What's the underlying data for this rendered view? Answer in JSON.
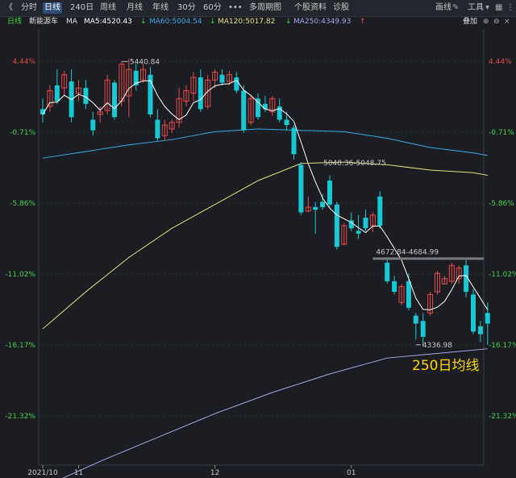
{
  "toolbar": {
    "items": [
      "《",
      "分时",
      "日线",
      "240日",
      "周线",
      "月线",
      "年线",
      "30分",
      "60分",
      "•••",
      "多周期图",
      "个股资料",
      "诊股"
    ],
    "right": [
      "画线",
      "工具"
    ]
  },
  "infobar": {
    "period": "日线",
    "name": "新能源车",
    "ma_label": "MA",
    "ma5": "MA5:4520.43",
    "ma60": "MA60:5004.54",
    "ma120": "MA120:5017.82",
    "ma250": "MA250:4349.93",
    "arrow_down": "↓",
    "arrow_up": "↑",
    "right_label": "叠加"
  },
  "colors": {
    "background": "#1b1d22",
    "up": "#e84a4a",
    "down": "#17c9d6",
    "ma5": "#ffffff",
    "ma60": "#3aa8e0",
    "ma120": "#e3e07a",
    "ma250": "#a7a7e8",
    "pos": "#e84a4a",
    "zero": "#3fd14a",
    "neg": "#3fd14a",
    "annotation": "#ffd700"
  },
  "chart_data": {
    "type": "candlestick",
    "y_percent_ticks": [
      "4.44%",
      "-0.71%",
      "-5.86%",
      "-11.02%",
      "-16.17%",
      "-21.32%"
    ],
    "y_values": [
      4.44,
      -0.71,
      -5.86,
      -11.02,
      -16.17,
      -21.32
    ],
    "x_ticks": [
      "2021/10",
      "11",
      "12",
      "01"
    ],
    "x_tick_index": [
      0,
      5,
      24,
      43
    ],
    "callouts": [
      "5440.84",
      "5048.36-5048.75",
      "4672.84-4684.99",
      "4336.98"
    ],
    "annotation": "250日均线",
    "price_ref": 5200,
    "candles": [
      {
        "o": 5250,
        "h": 5290,
        "l": 5200,
        "c": 5230
      },
      {
        "o": 5260,
        "h": 5340,
        "l": 5240,
        "c": 5320
      },
      {
        "o": 5340,
        "h": 5400,
        "l": 5270,
        "c": 5280
      },
      {
        "o": 5330,
        "h": 5395,
        "l": 5300,
        "c": 5380
      },
      {
        "o": 5355,
        "h": 5400,
        "l": 5200,
        "c": 5220
      },
      {
        "o": 5310,
        "h": 5360,
        "l": 5280,
        "c": 5330
      },
      {
        "o": 5330,
        "h": 5360,
        "l": 5250,
        "c": 5270
      },
      {
        "o": 5210,
        "h": 5240,
        "l": 5150,
        "c": 5170
      },
      {
        "o": 5230,
        "h": 5260,
        "l": 5200,
        "c": 5240
      },
      {
        "o": 5245,
        "h": 5380,
        "l": 5230,
        "c": 5360
      },
      {
        "o": 5350,
        "h": 5360,
        "l": 5210,
        "c": 5220
      },
      {
        "o": 5280,
        "h": 5430,
        "l": 5260,
        "c": 5420
      },
      {
        "o": 5300,
        "h": 5440,
        "l": 5220,
        "c": 5400
      },
      {
        "o": 5395,
        "h": 5420,
        "l": 5320,
        "c": 5340
      },
      {
        "o": 5360,
        "h": 5420,
        "l": 5350,
        "c": 5400
      },
      {
        "o": 5380,
        "h": 5410,
        "l": 5220,
        "c": 5230
      },
      {
        "o": 5210,
        "h": 5250,
        "l": 5130,
        "c": 5140
      },
      {
        "o": 5150,
        "h": 5210,
        "l": 5130,
        "c": 5190
      },
      {
        "o": 5175,
        "h": 5210,
        "l": 5160,
        "c": 5200
      },
      {
        "o": 5200,
        "h": 5330,
        "l": 5180,
        "c": 5290
      },
      {
        "o": 5280,
        "h": 5340,
        "l": 5260,
        "c": 5320
      },
      {
        "o": 5310,
        "h": 5390,
        "l": 5280,
        "c": 5370
      },
      {
        "o": 5370,
        "h": 5400,
        "l": 5240,
        "c": 5250
      },
      {
        "o": 5260,
        "h": 5380,
        "l": 5250,
        "c": 5360
      },
      {
        "o": 5360,
        "h": 5400,
        "l": 5330,
        "c": 5390
      },
      {
        "o": 5380,
        "h": 5400,
        "l": 5340,
        "c": 5350
      },
      {
        "o": 5355,
        "h": 5395,
        "l": 5340,
        "c": 5380
      },
      {
        "o": 5370,
        "h": 5390,
        "l": 5310,
        "c": 5320
      },
      {
        "o": 5320,
        "h": 5340,
        "l": 5160,
        "c": 5170
      },
      {
        "o": 5200,
        "h": 5300,
        "l": 5190,
        "c": 5290
      },
      {
        "o": 5290,
        "h": 5310,
        "l": 5210,
        "c": 5220
      },
      {
        "o": 5270,
        "h": 5300,
        "l": 5240,
        "c": 5250
      },
      {
        "o": 5240,
        "h": 5300,
        "l": 5225,
        "c": 5290
      },
      {
        "o": 5260,
        "h": 5290,
        "l": 5200,
        "c": 5210
      },
      {
        "o": 5210,
        "h": 5240,
        "l": 5170,
        "c": 5190
      },
      {
        "o": 5180,
        "h": 5190,
        "l": 5060,
        "c": 5080
      },
      {
        "o": 5040,
        "h": 5050,
        "l": 4850,
        "c": 4860
      },
      {
        "o": 4865,
        "h": 4920,
        "l": 4860,
        "c": 4880
      },
      {
        "o": 4880,
        "h": 4900,
        "l": 4780,
        "c": 4870
      },
      {
        "o": 4900,
        "h": 4930,
        "l": 4870,
        "c": 4880
      },
      {
        "o": 4980,
        "h": 5000,
        "l": 4880,
        "c": 4890
      },
      {
        "o": 4890,
        "h": 4900,
        "l": 4720,
        "c": 4730
      },
      {
        "o": 4740,
        "h": 4820,
        "l": 4735,
        "c": 4810
      },
      {
        "o": 4830,
        "h": 4860,
        "l": 4790,
        "c": 4800
      },
      {
        "o": 4790,
        "h": 4850,
        "l": 4760,
        "c": 4780
      },
      {
        "o": 4840,
        "h": 4870,
        "l": 4790,
        "c": 4800
      },
      {
        "o": 4810,
        "h": 4860,
        "l": 4785,
        "c": 4850
      },
      {
        "o": 4920,
        "h": 4940,
        "l": 4800,
        "c": 4810
      },
      {
        "o": 4670,
        "h": 4690,
        "l": 4590,
        "c": 4600
      },
      {
        "o": 4600,
        "h": 4620,
        "l": 4550,
        "c": 4560
      },
      {
        "o": 4520,
        "h": 4590,
        "l": 4510,
        "c": 4580
      },
      {
        "o": 4600,
        "h": 4630,
        "l": 4490,
        "c": 4500
      },
      {
        "o": 4470,
        "h": 4480,
        "l": 4380,
        "c": 4440
      },
      {
        "o": 4450,
        "h": 4480,
        "l": 4360,
        "c": 4390
      },
      {
        "o": 4480,
        "h": 4560,
        "l": 4470,
        "c": 4550
      },
      {
        "o": 4560,
        "h": 4640,
        "l": 4550,
        "c": 4630
      },
      {
        "o": 4590,
        "h": 4620,
        "l": 4590,
        "c": 4610
      },
      {
        "o": 4600,
        "h": 4670,
        "l": 4590,
        "c": 4660
      },
      {
        "o": 4610,
        "h": 4660,
        "l": 4590,
        "c": 4650
      },
      {
        "o": 4660,
        "h": 4680,
        "l": 4540,
        "c": 4560
      },
      {
        "o": 4550,
        "h": 4570,
        "l": 4400,
        "c": 4410
      },
      {
        "o": 4430,
        "h": 4450,
        "l": 4370,
        "c": 4400
      },
      {
        "o": 4480,
        "h": 4520,
        "l": 4360,
        "c": 4440
      }
    ]
  }
}
